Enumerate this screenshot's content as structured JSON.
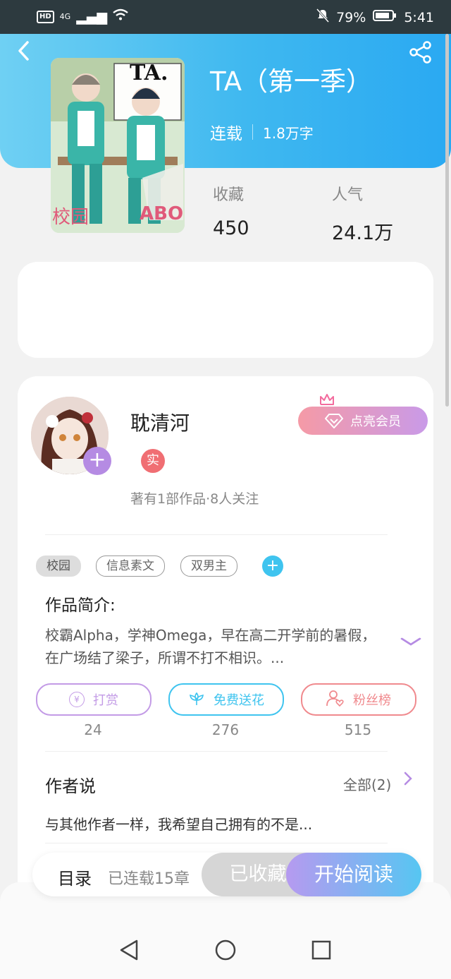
{
  "status_bar": {
    "signal": "4G",
    "battery": "79%",
    "time": "5:41",
    "hd": "HD"
  },
  "book": {
    "title": "TA（第一季）",
    "status": "连载",
    "word_count": "1.8万字",
    "cover_title": "TA.",
    "cover_tag_left": "校园",
    "cover_tag_right": "ABO"
  },
  "stats": {
    "favorites_label": "收藏",
    "favorites_value": "450",
    "popularity_label": "人气",
    "popularity_value": "24.1万"
  },
  "author": {
    "name": "耽清河",
    "verified_badge": "实",
    "meta": "著有1部作品·8人关注",
    "vip_label": "点亮会员"
  },
  "tags": [
    "校园",
    "信息素文",
    "双男主"
  ],
  "intro": {
    "label": "作品简介:",
    "text": "校霸Alpha，学神Omega，早在高二开学前的暑假，在广场结了梁子，所谓不打不相识。..."
  },
  "actions": [
    {
      "label": "打赏",
      "count": "24",
      "color": "#c39be6"
    },
    {
      "label": "免费送花",
      "count": "276",
      "color": "#3fc4ef"
    },
    {
      "label": "粉丝榜",
      "count": "515",
      "color": "#f08a8e"
    }
  ],
  "author_says": {
    "label": "作者说",
    "all": "全部(2)",
    "text": "与其他作者一样，我希望自己拥有的不是..."
  },
  "bottom": {
    "toc": "目录",
    "chapters": "已连载15章",
    "collected": "已收藏",
    "start": "开始阅读"
  }
}
